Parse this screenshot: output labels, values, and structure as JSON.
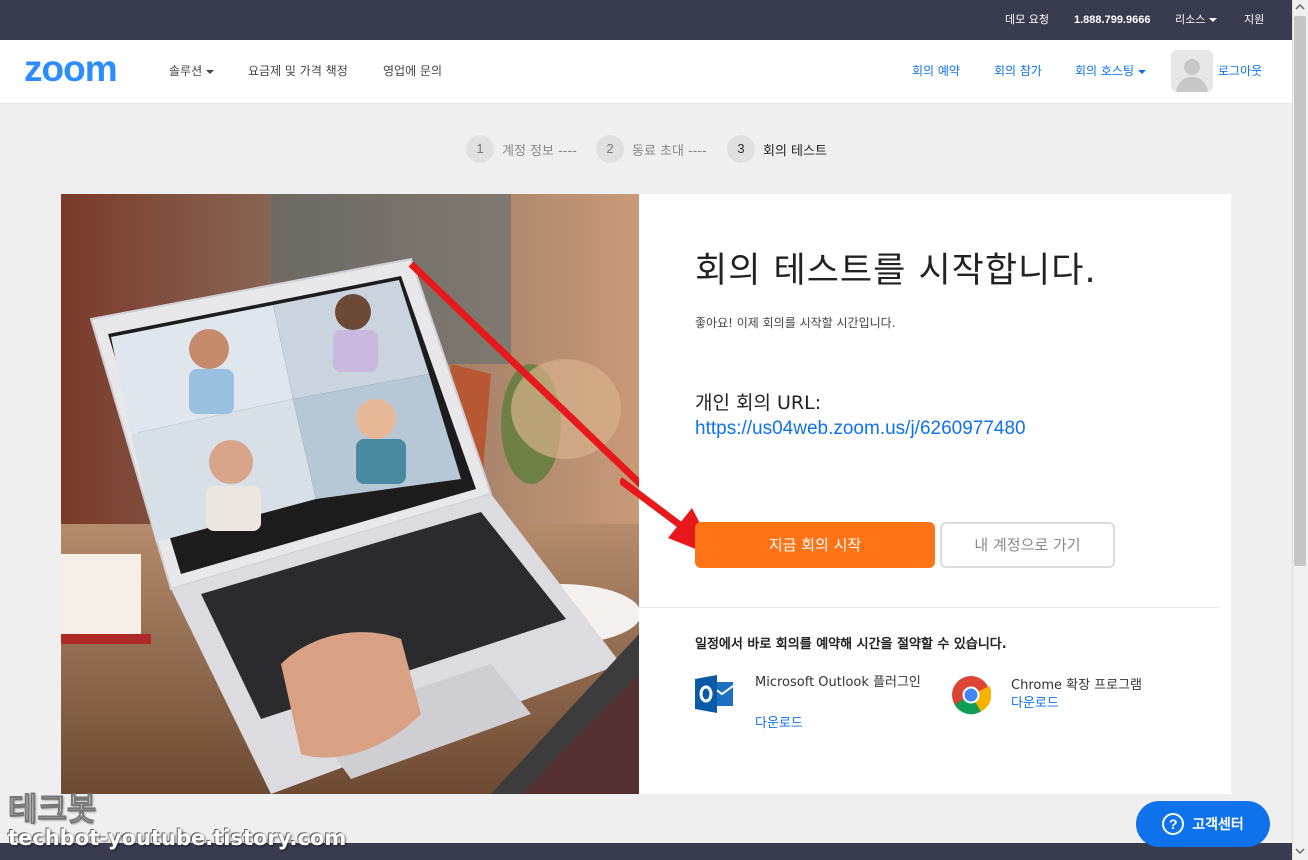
{
  "topbar": {
    "demo": "데모 요청",
    "phone": "1.888.799.9666",
    "resources": "리소스",
    "support": "지원"
  },
  "nav": {
    "logo": "zoom",
    "left": [
      "솔루션",
      "요금제 및 가격 책정",
      "영업에 문의"
    ],
    "right": [
      "회의 예약",
      "회의 참가",
      "회의 호스팅"
    ],
    "logout": "로그아웃"
  },
  "steps": [
    {
      "num": "1",
      "label": "계정 정보 ----"
    },
    {
      "num": "2",
      "label": "동료 초대 ----"
    },
    {
      "num": "3",
      "label": "회의 테스트"
    }
  ],
  "main": {
    "heading": "회의 테스트를 시작합니다.",
    "subtext": "좋아요! 이제 회의를 시작할 시간입니다.",
    "url_label": "개인 회의 URL:",
    "url": "https://us04web.zoom.us/j/6260977480",
    "start_button": "지금 회의 시작",
    "account_button": "내 계정으로 가기",
    "schedule_text": "일정에서 바로 회의를 예약해 시간을 절약할 수 있습니다.",
    "outlook_title": "Microsoft Outlook 플러그인",
    "outlook_download": "다운로드",
    "chrome_title": "Chrome 확장 프로그램",
    "chrome_download": "다운로드"
  },
  "help": {
    "label": "고객센터"
  },
  "watermark": {
    "line1": "테크봇",
    "line2": "techbot-youtube.tistory.com"
  },
  "colors": {
    "accent": "#0e72ed",
    "start": "#ff7416",
    "topbar": "#393b4f"
  }
}
